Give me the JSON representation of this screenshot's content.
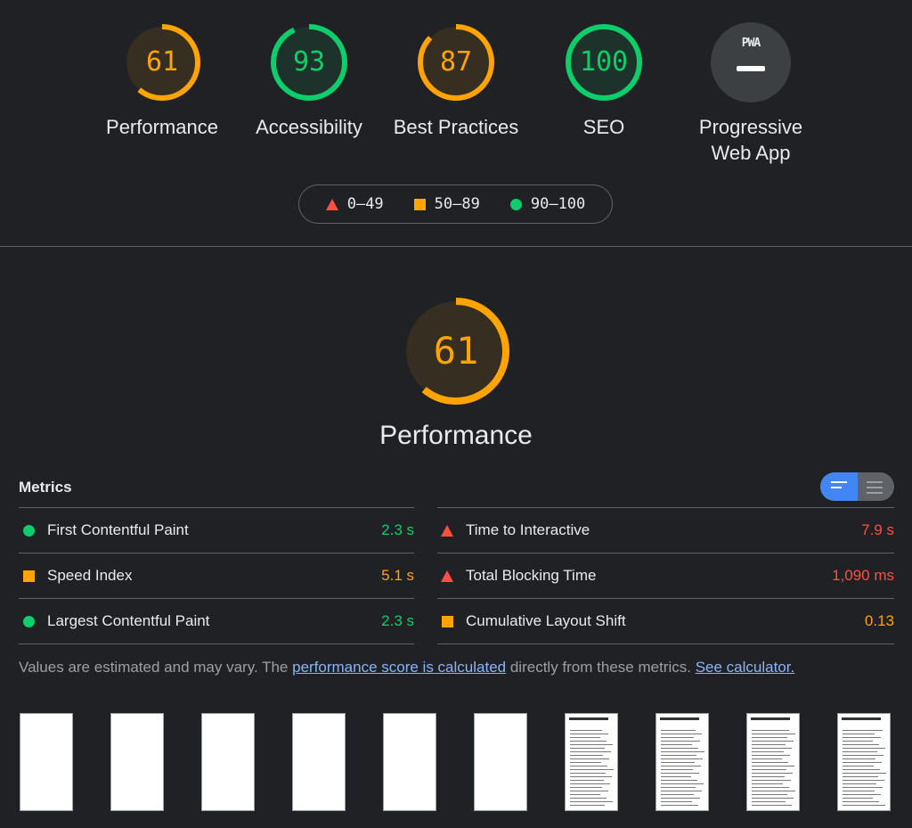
{
  "categories": [
    {
      "id": "performance",
      "score": "61",
      "label": "Performance",
      "color": "#ffa400",
      "fraction": 0.61
    },
    {
      "id": "accessibility",
      "score": "93",
      "label": "Accessibility",
      "color": "#0cce6b",
      "fraction": 0.93
    },
    {
      "id": "best-practices",
      "score": "87",
      "label": "Best Practices",
      "color": "#ffa400",
      "fraction": 0.87
    },
    {
      "id": "seo",
      "score": "100",
      "label": "SEO",
      "color": "#0cce6b",
      "fraction": 1.0
    },
    {
      "id": "pwa",
      "score": "",
      "label": "Progressive Web App",
      "badge_text": "PWA"
    }
  ],
  "legend": {
    "fail": "0–49",
    "average": "50–89",
    "pass": "90–100"
  },
  "performance": {
    "score": "61",
    "fraction": 0.61,
    "label": "Performance",
    "color": "#ffa400"
  },
  "metrics": {
    "title": "Metrics",
    "left": [
      {
        "name": "First Contentful Paint",
        "value": "2.3 s",
        "rating": "pass"
      },
      {
        "name": "Speed Index",
        "value": "5.1 s",
        "rating": "average"
      },
      {
        "name": "Largest Contentful Paint",
        "value": "2.3 s",
        "rating": "pass"
      }
    ],
    "right": [
      {
        "name": "Time to Interactive",
        "value": "7.9 s",
        "rating": "fail"
      },
      {
        "name": "Total Blocking Time",
        "value": "1,090 ms",
        "rating": "fail"
      },
      {
        "name": "Cumulative Layout Shift",
        "value": "0.13",
        "rating": "average"
      }
    ]
  },
  "note": {
    "text1": "Values are estimated and may vary. The ",
    "link1": "performance score is calculated",
    "text2": " directly from these metrics. ",
    "link2": "See calculator."
  },
  "colors": {
    "pass": "#0cce6b",
    "average": "#ffa400",
    "fail": "#ff4e42",
    "accent": "#4285f4"
  },
  "filmstrip": {
    "frames": [
      "blank",
      "blank",
      "blank",
      "blank",
      "blank",
      "blank",
      "content",
      "content",
      "content",
      "content"
    ]
  }
}
